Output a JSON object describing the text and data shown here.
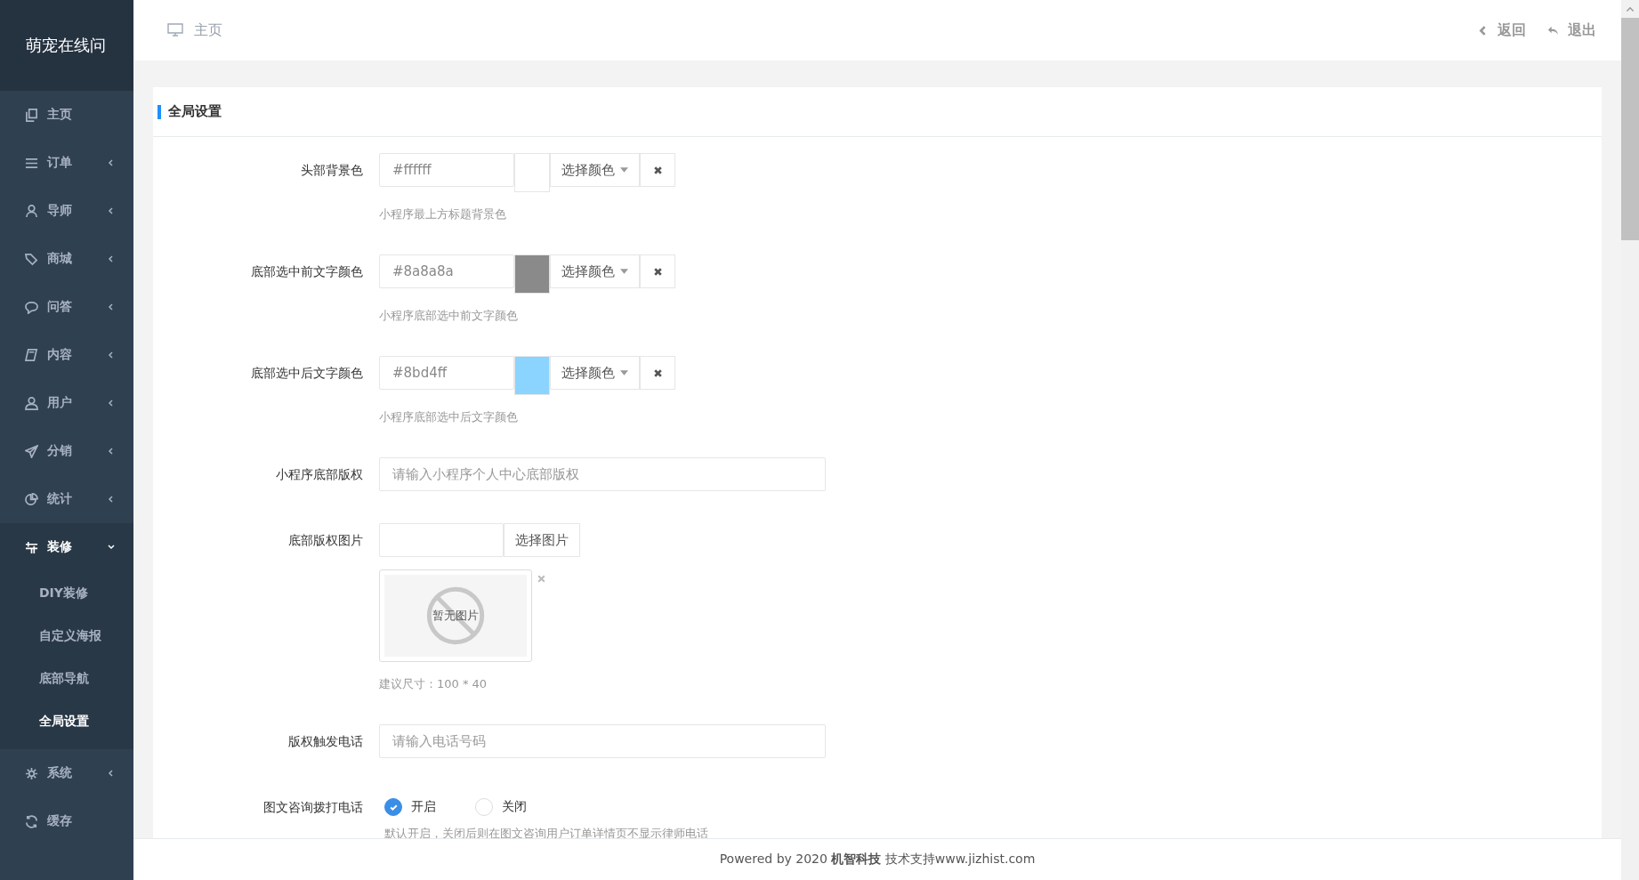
{
  "sidebar": {
    "logo": "萌宠在线问",
    "items": [
      {
        "kind": "link",
        "label": "主页"
      },
      {
        "kind": "menu",
        "label": "订单",
        "expanded": false
      },
      {
        "kind": "menu",
        "label": "导师",
        "expanded": false
      },
      {
        "kind": "menu",
        "label": "商城",
        "expanded": false
      },
      {
        "kind": "menu",
        "label": "问答",
        "expanded": false
      },
      {
        "kind": "menu",
        "label": "内容",
        "expanded": false
      },
      {
        "kind": "menu",
        "label": "用户",
        "expanded": false
      },
      {
        "kind": "menu",
        "label": "分销",
        "expanded": false
      },
      {
        "kind": "menu",
        "label": "统计",
        "expanded": false
      },
      {
        "kind": "menu",
        "label": "装修",
        "expanded": true,
        "children": [
          {
            "label": "DIY装修",
            "selected": false
          },
          {
            "label": "自定义海报",
            "selected": false
          },
          {
            "label": "底部导航",
            "selected": false
          },
          {
            "label": "全局设置",
            "selected": true
          }
        ]
      },
      {
        "kind": "menu",
        "label": "系统",
        "expanded": false
      },
      {
        "kind": "link",
        "label": "缓存"
      }
    ]
  },
  "header": {
    "breadcrumb": "主页",
    "actions": [
      "返回",
      "退出"
    ]
  },
  "panel": {
    "title": "全局设置",
    "fields": [
      {
        "kind": "color",
        "label": "头部背景色",
        "value": "#ffffff",
        "button": "选择颜色",
        "hint": "小程序最上方标题背景色"
      },
      {
        "kind": "color",
        "label": "底部选中前文字颜色",
        "value": "#8a8a8a",
        "button": "选择颜色",
        "hint": "小程序底部选中前文字颜色"
      },
      {
        "kind": "color",
        "label": "底部选中后文字颜色",
        "value": "#8bd4ff",
        "button": "选择颜色",
        "hint": "小程序底部选中后文字颜色"
      },
      {
        "kind": "text",
        "label": "小程序底部版权",
        "placeholder": "请输入小程序个人中心底部版权"
      },
      {
        "kind": "image",
        "label": "底部版权图片",
        "button": "选择图片",
        "image_placeholder": "暂无图片",
        "hint": "建议尺寸：100 * 40"
      },
      {
        "kind": "text",
        "label": "版权触发电话",
        "placeholder": "请输入电话号码"
      },
      {
        "kind": "radio",
        "label": "图文咨询拨打电话",
        "options": [
          {
            "label": "开启",
            "selected": true
          },
          {
            "label": "关闭",
            "selected": false
          }
        ],
        "hint": "默认开启，关闭后则在图文咨询用户订单详情页不显示律师电话"
      }
    ]
  },
  "footer": "Powered by 2020 **机智科技** 技术支持www.jizhist.com"
}
